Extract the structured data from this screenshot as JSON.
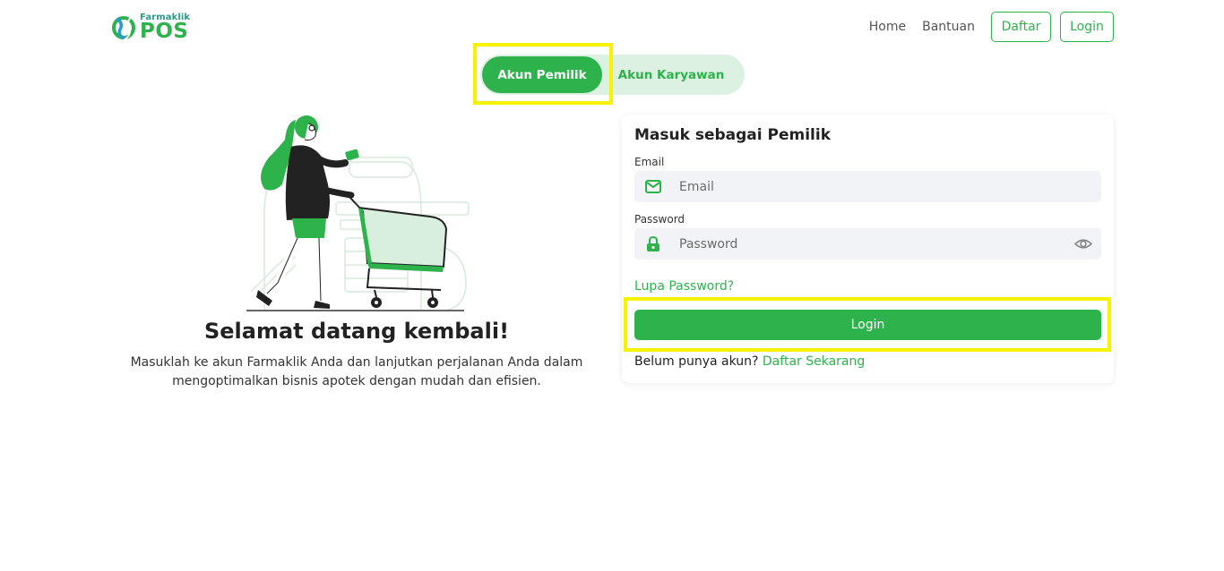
{
  "header": {
    "logo_small": "Farmaklik",
    "logo_big": "POS",
    "nav": {
      "home": "Home",
      "help": "Bantuan",
      "register": "Daftar",
      "login": "Login"
    }
  },
  "tabs": {
    "owner": "Akun Pemilik",
    "employee": "Akun Karyawan",
    "active": "owner"
  },
  "welcome": {
    "title": "Selamat datang kembali!",
    "subtitle_line1": "Masuklah ke akun Farmaklik Anda dan lanjutkan perjalanan Anda dalam",
    "subtitle_line2": "mengoptimalkan bisnis apotek dengan mudah dan efisien."
  },
  "form": {
    "title": "Masuk sebagai Pemilik",
    "email": {
      "label": "Email",
      "placeholder": "Email",
      "icon": "mail-icon"
    },
    "password": {
      "label": "Password",
      "placeholder": "Password",
      "icon": "lock-icon",
      "toggle_icon": "eye-icon"
    },
    "forgot": "Lupa Password?",
    "submit": "Login",
    "signup_prompt": "Belum punya akun?",
    "signup_link": "Daftar Sekarang"
  },
  "colors": {
    "primary": "#2db24c",
    "tab_bg": "#dcf1e1",
    "highlight": "#f7f300",
    "field_bg": "#f2f3f7"
  }
}
